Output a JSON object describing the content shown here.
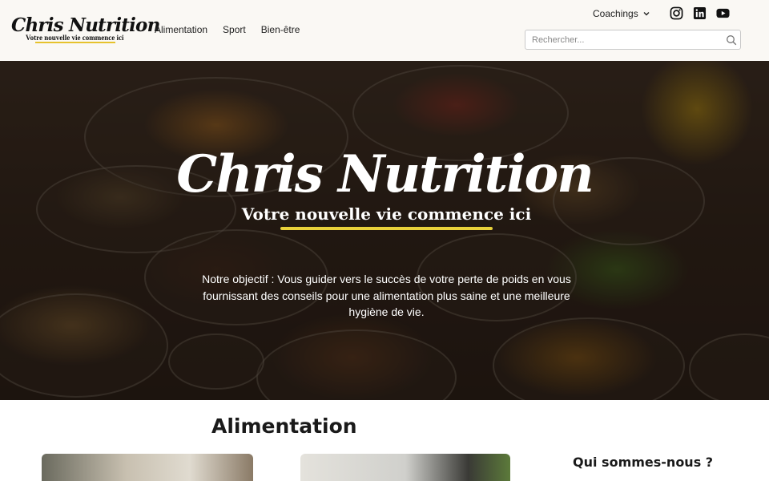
{
  "header": {
    "logo": {
      "title": "Chris Nutrition",
      "subtitle": "Votre nouvelle vie commence ici"
    },
    "nav": [
      "Alimentation",
      "Sport",
      "Bien-être"
    ],
    "coachings_label": "Coachings",
    "socials": [
      "instagram-icon",
      "linkedin-icon",
      "youtube-icon"
    ],
    "search": {
      "placeholder": "Rechercher...",
      "value": ""
    }
  },
  "hero": {
    "title": "Chris Nutrition",
    "subtitle": "Votre nouvelle vie commence ici",
    "text": "Notre objectif : Vous guider vers le succès de votre perte de poids en vous fournissant des conseils pour une alimentation plus saine et une meilleure hygiène de vie."
  },
  "main": {
    "section_title": "Alimentation",
    "sidebar_title": "Qui sommes-nous ?"
  },
  "colors": {
    "accent_yellow": "#e8d13a",
    "header_bg": "#faf8f4"
  }
}
